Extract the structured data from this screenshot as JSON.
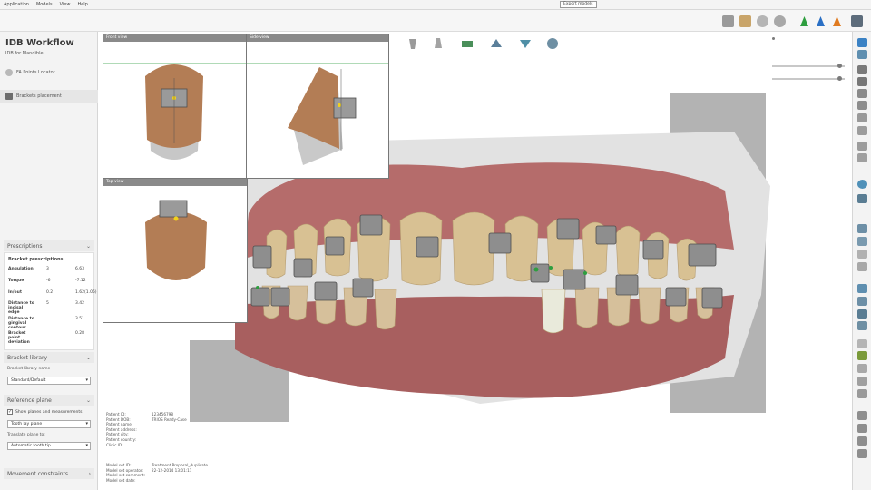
{
  "menu": {
    "items": [
      "Application",
      "Models",
      "View",
      "Help"
    ],
    "tooltip": "Export models"
  },
  "workflow": {
    "title": "IDB Workflow",
    "subtitle": "IDB for Mandible",
    "steps": [
      {
        "label": "FA Points Locator",
        "icon": "tooth-points-icon"
      },
      {
        "label": "Brackets placement",
        "icon": "bracket-placement-icon"
      }
    ]
  },
  "prescriptions": {
    "header": "Prescriptions",
    "table_title": "Bracket prescriptions",
    "rows": [
      {
        "name": "Angulation",
        "a": "3",
        "b": "6.63"
      },
      {
        "name": "Torque",
        "a": "-6",
        "b": "-7.12"
      },
      {
        "name": "In/out",
        "a": "0.2",
        "b": "1.62(1.06)"
      },
      {
        "name": "Distance to incisal edge",
        "a": "5",
        "b": "3.42"
      },
      {
        "name": "Distance to gingival contour",
        "a": "",
        "b": "3.51"
      },
      {
        "name": "Bracket point deviation",
        "a": "",
        "b": "0.28"
      }
    ]
  },
  "bracket_library": {
    "header": "Bracket library",
    "field_label": "Bracket library name",
    "value": "Standard/Default"
  },
  "reference_plane": {
    "header": "Reference plane",
    "checkbox_label": "Show planes and measurements",
    "checked": true,
    "plane_value": "Tooth lay plane",
    "translate_label": "Translate plane to:",
    "translate_value": "Automatic tooth tip"
  },
  "movement": {
    "header": "Movement constraints"
  },
  "insets": {
    "front": "Front view",
    "side": "Side view",
    "top": "Top view"
  },
  "patient_info": [
    {
      "label": "Patient ID:",
      "value": "123456798"
    },
    {
      "label": "Patient DOB:",
      "value": ""
    },
    {
      "label": "Patient name:",
      "value": "TRIOS Ready-Case"
    },
    {
      "label": "Patient address:",
      "value": ""
    },
    {
      "label": "Patient city:",
      "value": ""
    },
    {
      "label": "Patient country:",
      "value": ""
    },
    {
      "label": "Clinic ID:",
      "value": ""
    }
  ],
  "model_info": [
    {
      "label": "Model set ID:",
      "value": "Treatment Proposal_duplicate"
    },
    {
      "label": "Model set operator:",
      "value": ""
    },
    {
      "label": "Model set comment:",
      "value": ""
    },
    {
      "label": "Model set date:",
      "value": "22-12-2014 13:01:11"
    }
  ],
  "colors": {
    "gum": "#b36b6a",
    "tooth": "#d9c29a",
    "bracket": "#8c8c8c",
    "accent_green": "#2e9e3f"
  }
}
